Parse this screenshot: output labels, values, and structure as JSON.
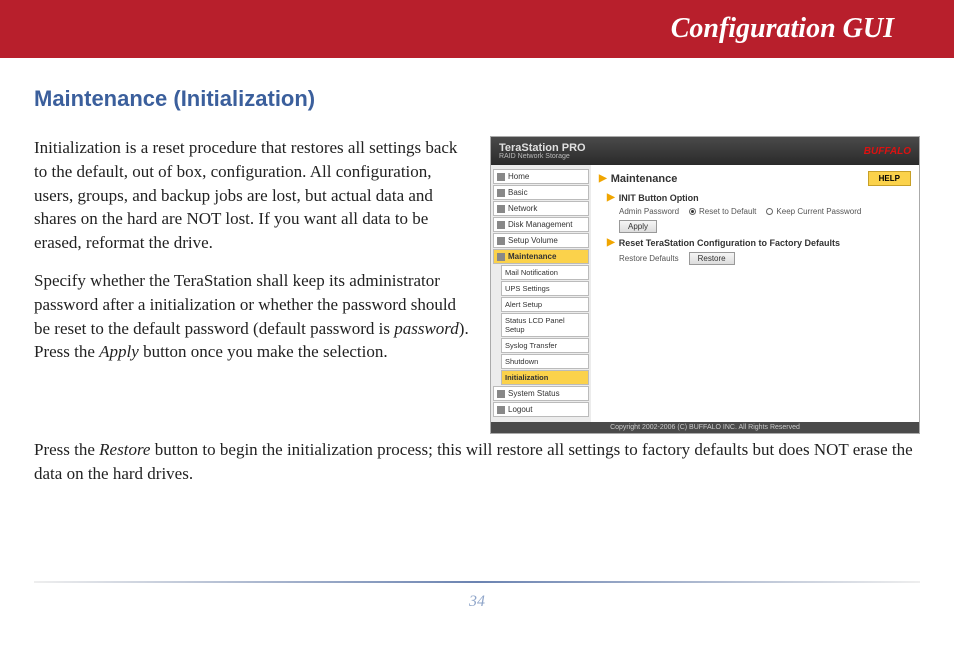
{
  "header": {
    "title": "Configuration GUI"
  },
  "section": {
    "title": "Maintenance (Initialization)"
  },
  "paragraphs": {
    "p1": "Initialization is a reset procedure that restores all settings back to the default, out of box, configuration.  All configuration, users, groups, and backup jobs are lost, but actual data and shares on the hard are NOT lost.  If you want all data to be erased, reformat the drive.",
    "p2a": "Specify whether the TeraStation shall keep its administrator password after a initialization or whether the password should be reset to the default password (default password is ",
    "p2_italic1": "password",
    "p2b": ").  Press the ",
    "p2_italic2": "Apply",
    "p2c": " button once you make the selection.",
    "p3a": "Press the ",
    "p3_italic1": "Restore",
    "p3b": " button to begin the initialization process; this will restore all settings to factory defaults but does NOT erase the data on the hard drives."
  },
  "gui": {
    "brand": "TeraStation PRO",
    "brand_sub": "RAID Network Storage",
    "logo": "BUFFALO",
    "nav": [
      {
        "label": "Home"
      },
      {
        "label": "Basic"
      },
      {
        "label": "Network"
      },
      {
        "label": "Disk Management"
      },
      {
        "label": "Setup Volume"
      },
      {
        "label": "Maintenance",
        "active": true
      }
    ],
    "sub_nav": [
      {
        "label": "Mail Notification"
      },
      {
        "label": "UPS Settings"
      },
      {
        "label": "Alert Setup"
      },
      {
        "label": "Status LCD Panel Setup"
      },
      {
        "label": "Syslog Transfer"
      },
      {
        "label": "Shutdown"
      },
      {
        "label": "Initialization",
        "active": true
      }
    ],
    "nav2": [
      {
        "label": "System Status"
      },
      {
        "label": "Logout"
      }
    ],
    "main_title": "Maintenance",
    "help": "HELP",
    "section1": {
      "title": "INIT Button Option",
      "row_label": "Admin Password",
      "radio1": "Reset to Default",
      "radio2": "Keep Current Password",
      "apply": "Apply"
    },
    "section2": {
      "title": "Reset TeraStation Configuration to Factory Defaults",
      "row_label": "Restore Defaults",
      "restore": "Restore"
    },
    "footer": "Copyright 2002-2006 (C) BUFFALO INC. All Rights Reserved"
  },
  "page_number": "34"
}
